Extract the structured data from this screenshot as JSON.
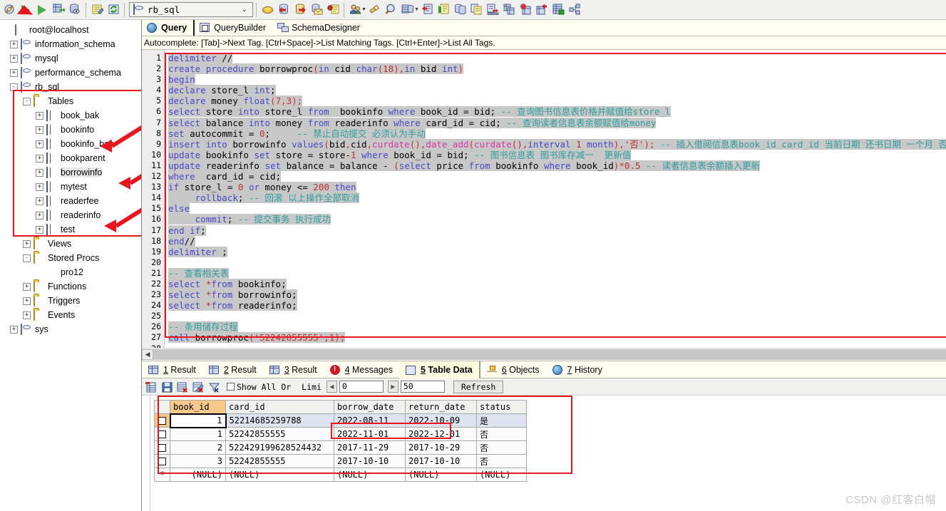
{
  "app": {
    "database_selector": "rb_sql",
    "watermark": "CSDN @红客白帽"
  },
  "toolbar": {
    "items": [
      {
        "name": "connection-manager-icon",
        "icon": "wrench-globe"
      },
      {
        "name": "execute-button",
        "icon": "play-green"
      },
      {
        "name": "execute-current-button",
        "icon": "play-step"
      },
      {
        "name": "execute-to-grid-button",
        "icon": "grid-arrow"
      },
      {
        "name": "explain-button",
        "icon": "db-eye"
      },
      {
        "name": "new-query-icon",
        "icon": "note-pencil"
      },
      {
        "name": "refresh-icon",
        "icon": "refresh-green"
      },
      {
        "name": "database-dropdown",
        "icon": "db-cylinder"
      },
      {
        "name": "create-database-icon",
        "icon": "coin-stack"
      },
      {
        "name": "backup-db-icon",
        "icon": "db-red"
      },
      {
        "name": "restore-db-icon",
        "icon": "db-yellow"
      },
      {
        "name": "mail-db-icon",
        "icon": "db-mail"
      },
      {
        "name": "db-script-icon",
        "icon": "db-script"
      },
      {
        "name": "user-manager-icon",
        "icon": "person"
      },
      {
        "name": "cleanup-icon",
        "icon": "brush"
      },
      {
        "name": "find-icon",
        "icon": "magnifier"
      },
      {
        "name": "table-view-icon",
        "icon": "table-blue"
      },
      {
        "name": "import-icon",
        "icon": "doc-red"
      },
      {
        "name": "export-icon",
        "icon": "doc-green"
      },
      {
        "name": "db-copy-icon",
        "icon": "db-copy"
      },
      {
        "name": "copy-icon",
        "icon": "copy-pages"
      },
      {
        "name": "transfer-icon",
        "icon": "doc-transfer"
      },
      {
        "name": "table-dup-icon",
        "icon": "table-dup"
      },
      {
        "name": "table-sync-icon",
        "icon": "table-sync"
      },
      {
        "name": "table-red-icon",
        "icon": "table-red"
      },
      {
        "name": "table-green-icon",
        "icon": "table-green"
      },
      {
        "name": "diagram-icon",
        "icon": "nodes"
      }
    ]
  },
  "sidebar": {
    "nodes": [
      {
        "label": "root@localhost",
        "icon": "server-icon",
        "indent": 0,
        "expander": "none"
      },
      {
        "label": "information_schema",
        "icon": "database-icon",
        "indent": 1,
        "expander": "+"
      },
      {
        "label": "mysql",
        "icon": "database-icon",
        "indent": 1,
        "expander": "+"
      },
      {
        "label": "performance_schema",
        "icon": "database-icon",
        "indent": 1,
        "expander": "+"
      },
      {
        "label": "rb_sql",
        "icon": "database-icon",
        "indent": 1,
        "expander": "-"
      },
      {
        "label": "Tables",
        "icon": "folder-icon",
        "indent": 2,
        "expander": "-"
      },
      {
        "label": "book_bak",
        "icon": "table-icon",
        "indent": 3,
        "expander": "+"
      },
      {
        "label": "bookinfo",
        "icon": "table-icon",
        "indent": 3,
        "expander": "+"
      },
      {
        "label": "bookinfo_bak",
        "icon": "table-icon",
        "indent": 3,
        "expander": "+"
      },
      {
        "label": "bookparent",
        "icon": "table-icon",
        "indent": 3,
        "expander": "+"
      },
      {
        "label": "borrowinfo",
        "icon": "table-icon",
        "indent": 3,
        "expander": "+",
        "selected": true
      },
      {
        "label": "mytest",
        "icon": "table-icon",
        "indent": 3,
        "expander": "+"
      },
      {
        "label": "readerfee",
        "icon": "table-icon",
        "indent": 3,
        "expander": "+"
      },
      {
        "label": "readerinfo",
        "icon": "table-icon",
        "indent": 3,
        "expander": "+"
      },
      {
        "label": "test",
        "icon": "table-icon",
        "indent": 3,
        "expander": "+"
      },
      {
        "label": "Views",
        "icon": "folder-icon",
        "indent": 2,
        "expander": "+"
      },
      {
        "label": "Stored Procs",
        "icon": "folder-icon",
        "indent": 2,
        "expander": "-"
      },
      {
        "label": "pro12",
        "icon": "procedure-icon",
        "indent": 3,
        "expander": "none"
      },
      {
        "label": "Functions",
        "icon": "folder-icon",
        "indent": 2,
        "expander": "+"
      },
      {
        "label": "Triggers",
        "icon": "folder-icon",
        "indent": 2,
        "expander": "+"
      },
      {
        "label": "Events",
        "icon": "folder-icon",
        "indent": 2,
        "expander": "+"
      },
      {
        "label": "sys",
        "icon": "database-icon",
        "indent": 1,
        "expander": "+"
      }
    ]
  },
  "page_tabs": [
    {
      "label": "Query",
      "icon": "globe-icon",
      "active": true
    },
    {
      "label": "QueryBuilder",
      "icon": "querybuilder-icon",
      "active": false
    },
    {
      "label": "SchemaDesigner",
      "icon": "schemadesigner-icon",
      "active": false
    }
  ],
  "autocomplete_hint": "Autocomplete: [Tab]->Next Tag. [Ctrl+Space]->List Matching Tags. [Ctrl+Enter]->List All Tags.",
  "editor": {
    "total_lines": 28,
    "lines": [
      {
        "n": 1,
        "text": "delimiter //"
      },
      {
        "n": 2,
        "text": "create procedure borrowproc(in cid char(18),in bid int)"
      },
      {
        "n": 3,
        "text": "begin"
      },
      {
        "n": 4,
        "text": "declare store_l int;"
      },
      {
        "n": 5,
        "text": "declare money float(7,3);"
      },
      {
        "n": 6,
        "text": "select store into store_l from  bookinfo where book_id = bid; -- 查询图书信息表价格并赋值给store_l"
      },
      {
        "n": 7,
        "text": "select balance into money from readerinfo where card_id = cid; -- 查询读者信息表余额赋值给money"
      },
      {
        "n": 8,
        "text": "set autocommit = 0;     -- 禁止自动提交 必须认为手动"
      },
      {
        "n": 9,
        "text": "insert into borrowinfo values(bid,cid,curdate(),date_add(curdate(),interval 1 month),'否'); -- 插入借阅信息表book_id card_id 当前日期 还书日期 一个月 否"
      },
      {
        "n": 10,
        "text": "update bookinfo set store = store-1 where book_id = bid; -- 图书信息表 图书库存减一  更新值"
      },
      {
        "n": 11,
        "text": "update readerinfo set balance = balance - (select price from bookinfo where book_id)*0.5 -- 读者信息表余额插入更新"
      },
      {
        "n": 12,
        "text": "where  card_id = cid;"
      },
      {
        "n": 13,
        "text": "if store_l = 0 or money <= 200 then"
      },
      {
        "n": 14,
        "text": "     rollback; -- 回滚 以上操作全部取消"
      },
      {
        "n": 15,
        "text": "else"
      },
      {
        "n": 16,
        "text": "     commit; -- 提交事务 执行成功"
      },
      {
        "n": 17,
        "text": "end if;"
      },
      {
        "n": 18,
        "text": "end//"
      },
      {
        "n": 19,
        "text": "delimiter ;"
      },
      {
        "n": 20,
        "text": ""
      },
      {
        "n": 21,
        "text": "-- 查看相关表"
      },
      {
        "n": 22,
        "text": "select *from bookinfo;"
      },
      {
        "n": 23,
        "text": "select *from borrowinfo;"
      },
      {
        "n": 24,
        "text": "select *from readerinfo;"
      },
      {
        "n": 25,
        "text": ""
      },
      {
        "n": 26,
        "text": "-- 条用储存过程"
      },
      {
        "n": 27,
        "text": "call borrowproc('52242855555',1);"
      },
      {
        "n": 28,
        "text": ""
      }
    ]
  },
  "result_tabs": [
    {
      "num": "1",
      "label": "Result",
      "icon": "grid-icon",
      "active": false
    },
    {
      "num": "2",
      "label": "Result",
      "icon": "grid-icon",
      "active": false
    },
    {
      "num": "3",
      "label": "Result",
      "icon": "grid-icon",
      "active": false
    },
    {
      "num": "4",
      "label": "Messages",
      "icon": "error-icon",
      "active": false
    },
    {
      "num": "5",
      "label": "Table Data",
      "icon": "table-data-icon",
      "active": true
    },
    {
      "num": "6",
      "label": "Objects",
      "icon": "objects-icon",
      "active": false
    },
    {
      "num": "7",
      "label": "History",
      "icon": "history-icon",
      "active": false
    }
  ],
  "data_toolbar": {
    "show_all_label": "Show All Or",
    "limit_label": "Limi",
    "offset_value": "0",
    "limit_value": "50",
    "refresh_label": "Refresh",
    "show_all_checked": false
  },
  "grid": {
    "columns": [
      "book_id",
      "card_id",
      "borrow_date",
      "return_date",
      "status"
    ],
    "selected_column": "book_id",
    "rows": [
      {
        "marker": "checkbox",
        "book_id": "1",
        "card_id": "52214685259788",
        "borrow_date": "2022-08-11",
        "return_date": "2022-10-09",
        "status": "是",
        "focused_cell": "book_id"
      },
      {
        "marker": "checkbox",
        "book_id": "1",
        "card_id": "52242855555",
        "borrow_date": "2022-11-01",
        "return_date": "2022-12-01",
        "status": "否"
      },
      {
        "marker": "checkbox",
        "book_id": "2",
        "card_id": "522429199628524432",
        "borrow_date": "2017-11-29",
        "return_date": "2017-10-29",
        "status": "否"
      },
      {
        "marker": "checkbox",
        "book_id": "3",
        "card_id": "52242855555",
        "borrow_date": "2017-10-10",
        "return_date": "2017-10-10",
        "status": "否"
      },
      {
        "marker": "*",
        "book_id": "(NULL)",
        "card_id": "(NULL)",
        "borrow_date": "(NULL)",
        "return_date": "(NULL)",
        "status": "(NULL)"
      }
    ]
  },
  "annotations": {
    "accent_color": "#e8171f",
    "arrow_targets": [
      "bookinfo",
      "borrowinfo",
      "readerinfo"
    ],
    "boxes": [
      "tables-tree",
      "sql-editor",
      "result-grid",
      "borrow-return-dates"
    ]
  }
}
